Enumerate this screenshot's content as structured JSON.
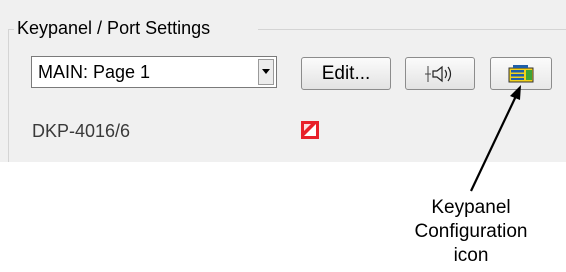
{
  "group": {
    "title": "Keypanel / Port Settings"
  },
  "dropdown": {
    "selected": "MAIN: Page 1"
  },
  "buttons": {
    "edit_label": "Edit..."
  },
  "device": {
    "model": "DKP-4016/6"
  },
  "callout": {
    "lines": [
      "Keypanel",
      "Configuration",
      "icon"
    ]
  },
  "icons": {
    "dropdown": "chevron-down-icon",
    "audio": "speaker-icon",
    "config": "keypanel-config-icon",
    "status": "status-flag-icon"
  },
  "colors": {
    "panel_bg": "#f0f0f0",
    "status_red": "#e8202a",
    "config_green": "#3fa535",
    "config_blue": "#1f5fa8",
    "config_yellow": "#f2d21b"
  }
}
